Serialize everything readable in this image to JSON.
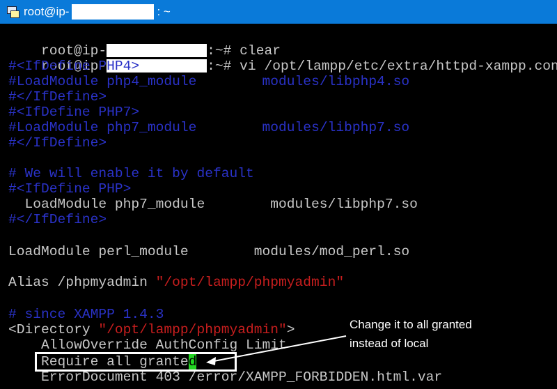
{
  "window": {
    "title_prefix": "root@ip-",
    "title_suffix": ": ~",
    "icon": "putty-icon"
  },
  "terminal": {
    "prompt_prefix": "root@ip-",
    "prompt_suffix": ":~# ",
    "cmd1": "clear",
    "cmd2": "vi /opt/lampp/etc/extra/httpd-xampp.conf",
    "l3": "#<IfDefine PHP4>",
    "l4a": "#LoadModule php4_module        ",
    "l4b": "modules/libphp4.so",
    "l5": "#</IfDefine>",
    "l6": "#<IfDefine PHP7>",
    "l7a": "#LoadModule php7_module        ",
    "l7b": "modules/libphp7.so",
    "l8": "#</IfDefine>",
    "l10": "# We will enable it by default",
    "l11": "#<IfDefine PHP>",
    "l12": "  LoadModule php7_module        modules/libphp7.so",
    "l13": "#</IfDefine>",
    "l15": "LoadModule perl_module        modules/mod_perl.so",
    "l17a": "Alias /phpmyadmin ",
    "l17b": "\"/opt/lampp/phpmyadmin\"",
    "l19": "# since XAMPP 1.4.3",
    "l20a": "<Directory ",
    "l20b": "\"/opt/lampp/phpmyadmin\"",
    "l20c": ">",
    "l21": "    AllowOverride AuthConfig Limit",
    "l22a": "    Require all grante",
    "l22cursor": "d",
    "l23": "    ErrorDocument 403 /error/XAMPP_FORBIDDEN.html.var"
  },
  "annotation": {
    "line1": "Change it to all granted",
    "line2": "instead of local"
  },
  "colors": {
    "titlebar": "#0a7ad9",
    "comment": "#2a32c8",
    "string": "#c81e1e",
    "text": "#c8c8c8",
    "cursor": "#22d622"
  }
}
